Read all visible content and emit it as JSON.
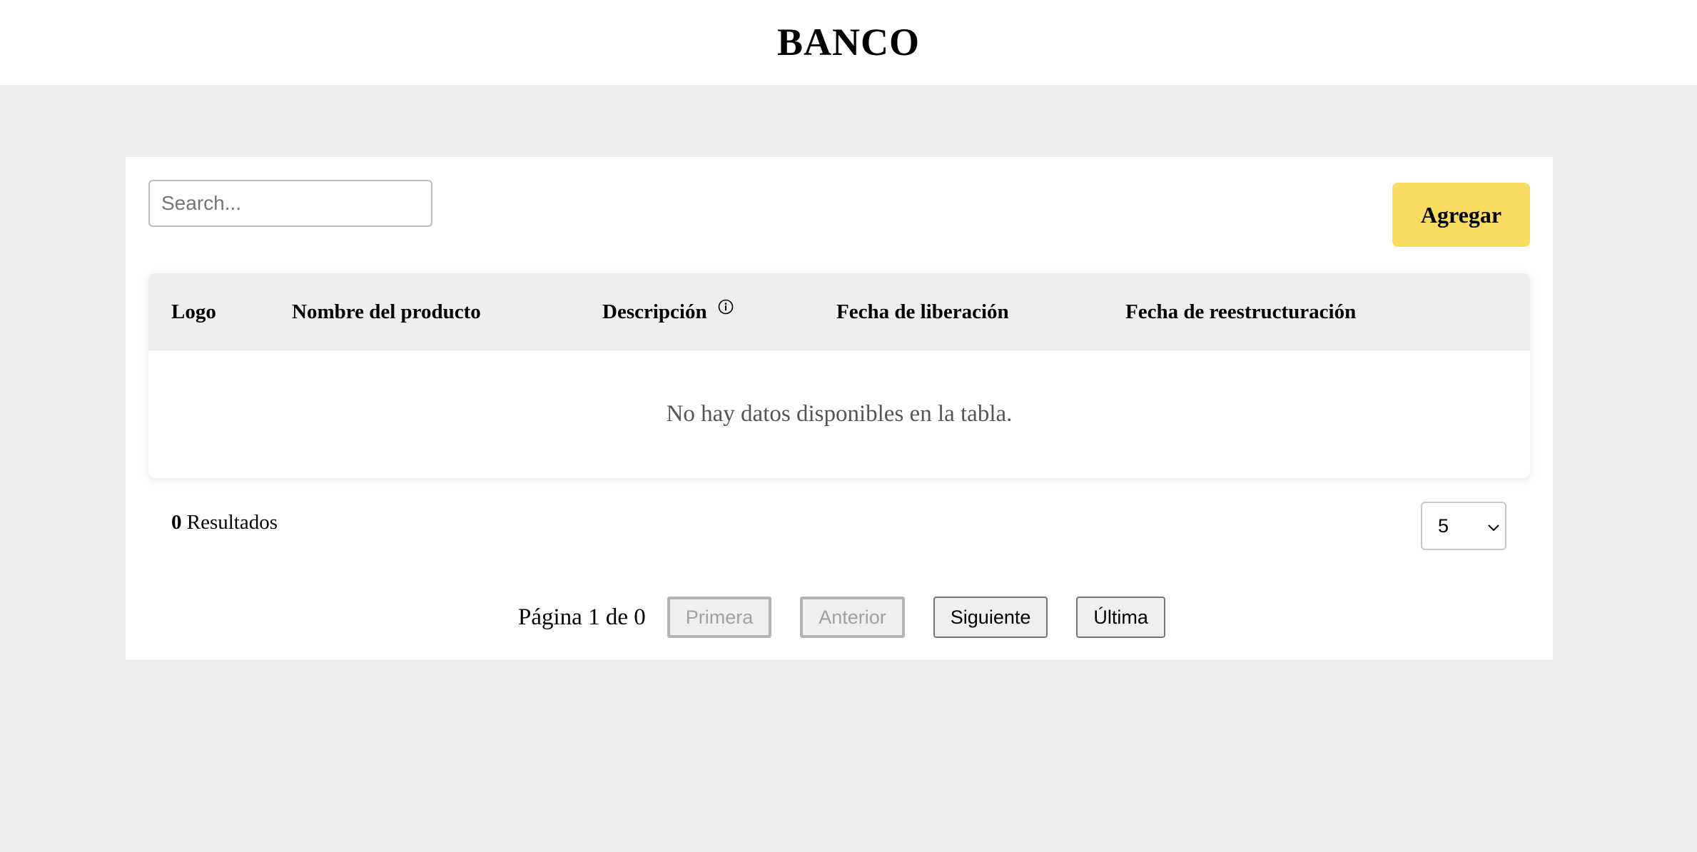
{
  "header": {
    "brand": "BANCO"
  },
  "toolbar": {
    "search_placeholder": "Search...",
    "search_value": "",
    "add_label": "Agregar"
  },
  "table": {
    "columns": [
      "Logo",
      "Nombre del producto",
      "Descripción",
      "Fecha de liberación",
      "Fecha de reestructuración"
    ],
    "rows": [],
    "empty_message": "No hay datos disponibles en la tabla."
  },
  "footer": {
    "results_count": "0",
    "results_label": "Resultados",
    "page_size": "5",
    "page_size_options": [
      "5"
    ]
  },
  "pagination": {
    "page_info": "Página 1 de 0",
    "first_label": "Primera",
    "prev_label": "Anterior",
    "next_label": "Siguiente",
    "last_label": "Última"
  },
  "colors": {
    "accent": "#f8dc62",
    "page_background": "#eceef0",
    "table_header_background": "#eceef0"
  },
  "icons": {
    "description_info": "info-icon",
    "page_size_dropdown": "chevron-down-icon"
  }
}
